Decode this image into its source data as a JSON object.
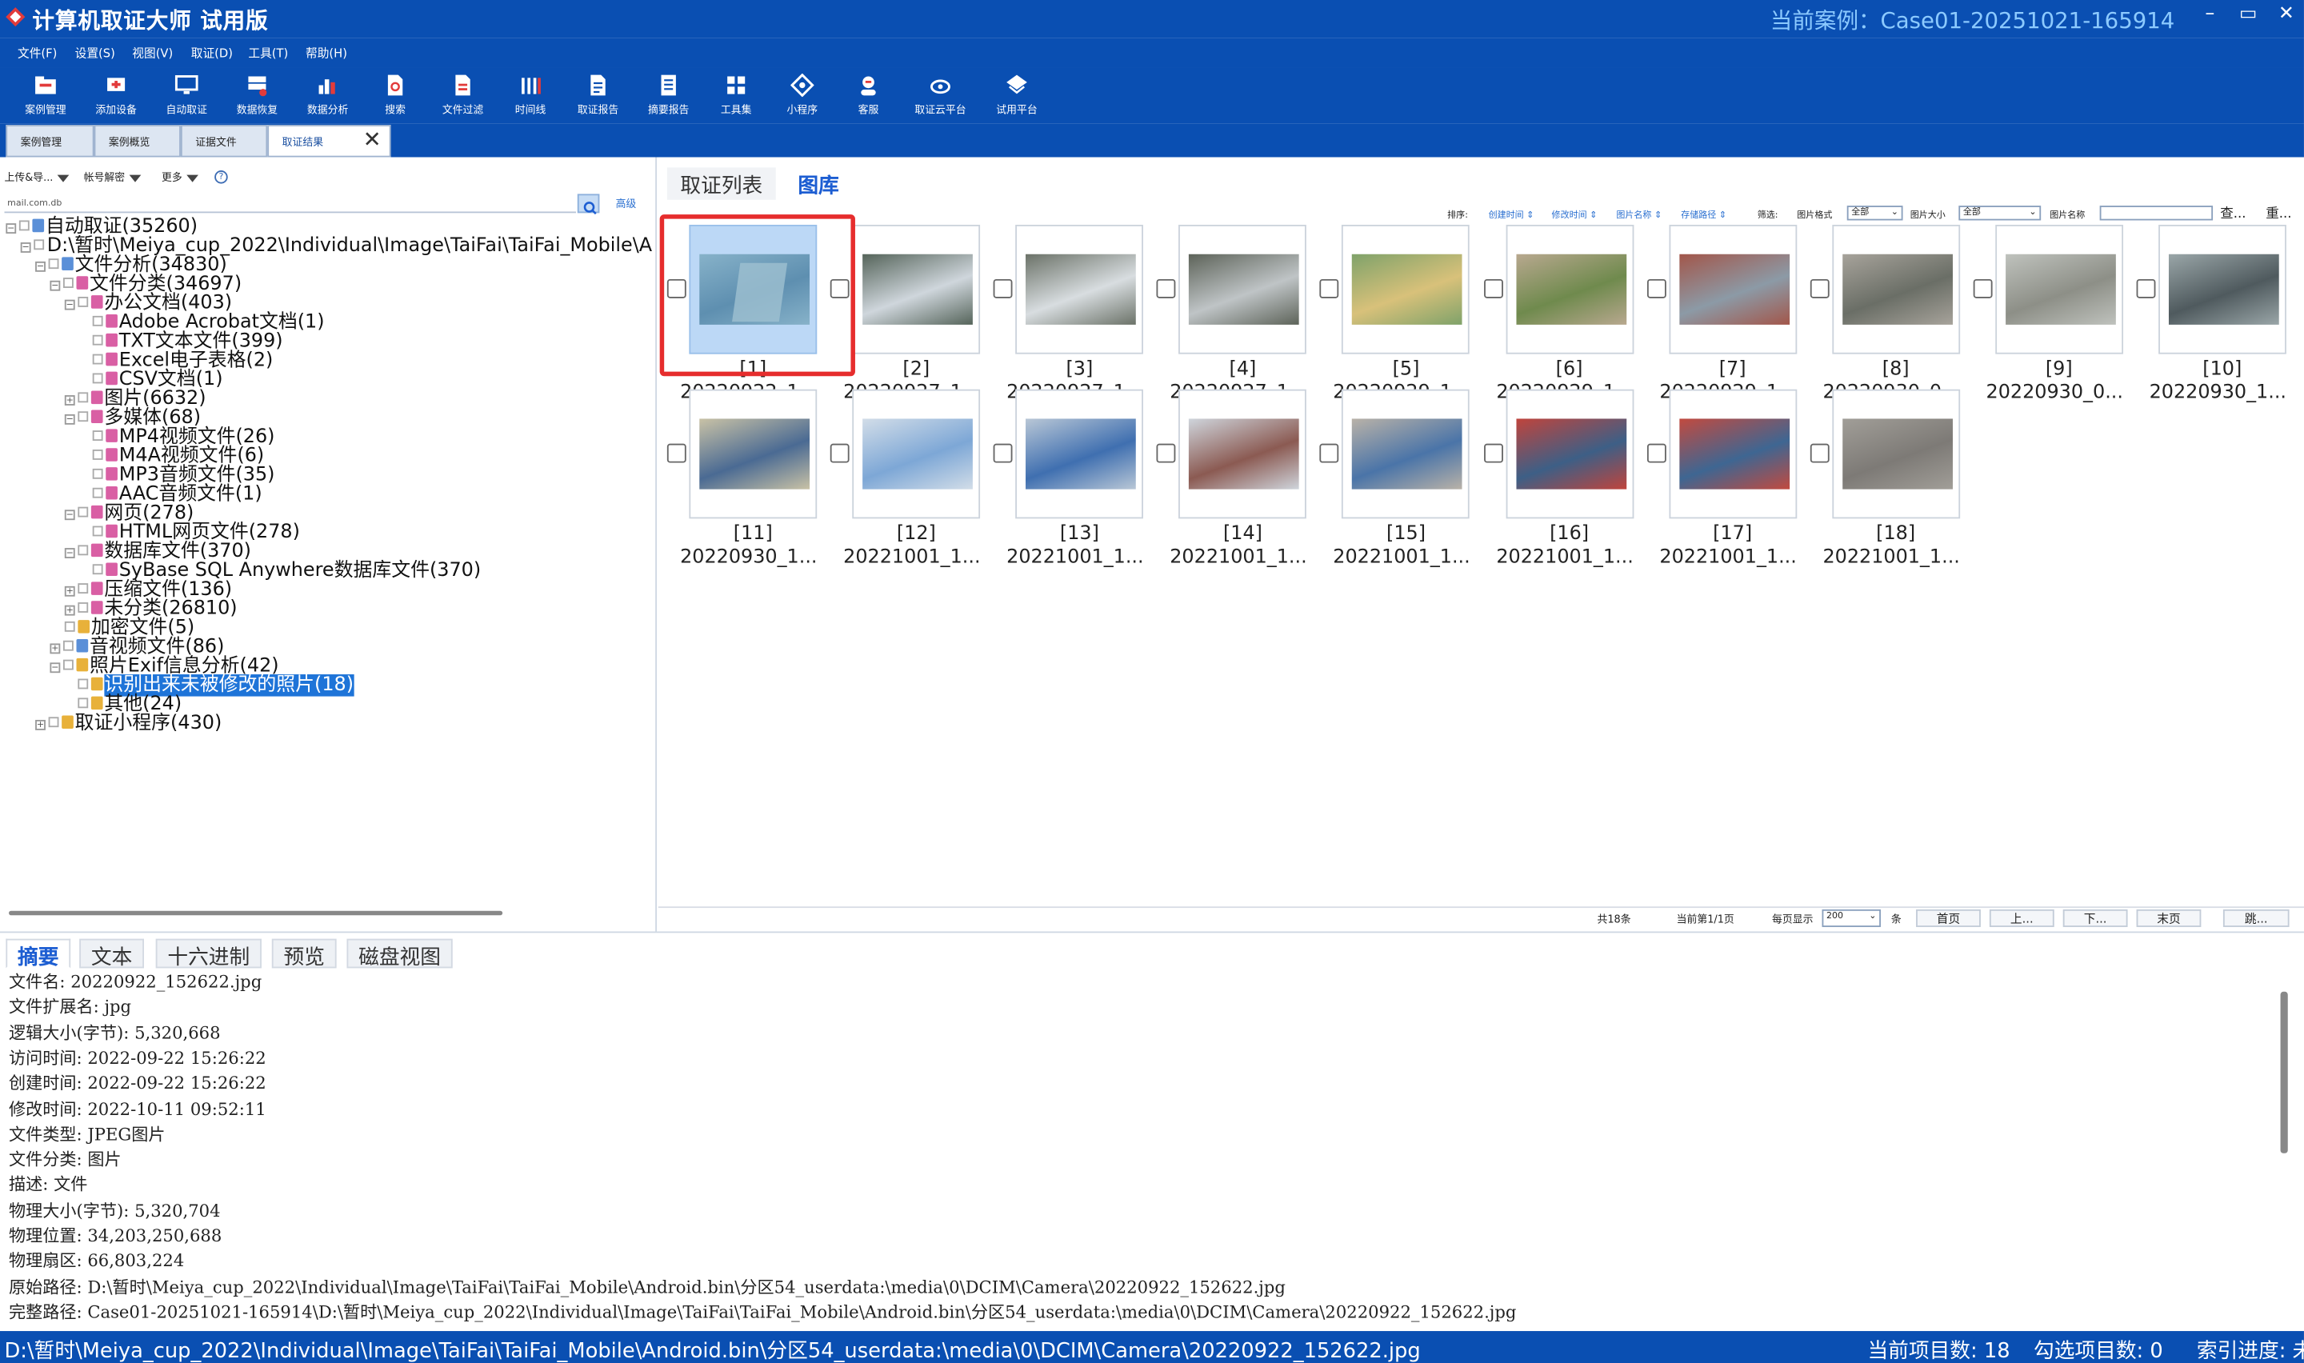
{
  "app": {
    "title": "计算机取证大师 试用版",
    "case": "当前案例：Case01-20251021-165914"
  },
  "window_buttons": [
    "–",
    "▭",
    "✕"
  ],
  "menu": [
    "文件(F)",
    "设置(S)",
    "视图(V)",
    "取证(D)",
    "工具(T)",
    "帮助(H)"
  ],
  "toolbar": [
    {
      "label": "案例管理",
      "icon": "folder-icon"
    },
    {
      "label": "添加设备",
      "icon": "add-device-icon"
    },
    {
      "label": "自动取证",
      "icon": "monitor-icon"
    },
    {
      "label": "数据恢复",
      "icon": "recover-icon"
    },
    {
      "label": "数据分析",
      "icon": "analysis-icon"
    },
    {
      "label": "搜索",
      "icon": "search-doc-icon"
    },
    {
      "label": "文件过滤",
      "icon": "filter-icon"
    },
    {
      "label": "时间线",
      "icon": "timeline-icon"
    },
    {
      "label": "取证报告",
      "icon": "report-icon"
    },
    {
      "label": "摘要报告",
      "icon": "summary-report-icon"
    },
    {
      "label": "工具集",
      "icon": "tools-grid-icon"
    },
    {
      "label": "小程序",
      "icon": "miniprogram-icon"
    },
    {
      "label": "客服",
      "icon": "support-icon"
    },
    {
      "label": "取证云平台",
      "icon": "cloud-icon"
    },
    {
      "label": "试用平台",
      "icon": "trial-icon"
    }
  ],
  "doc_tabs": [
    "案例管理",
    "案例概览",
    "证据文件",
    "取证结果"
  ],
  "left_toolbar": {
    "upload": "上传&导...",
    "decrypt": "帐号解密",
    "more": "更多",
    "help": "?"
  },
  "search": {
    "value": "mail.com.db",
    "advanced": "高级"
  },
  "tree": [
    "自动取证(35260)",
    "D:\\暂时\\Meiya_cup_2022\\Individual\\Image\\TaiFai\\TaiFai_Mobile\\A",
    "文件分析(34830)",
    "文件分类(34697)",
    "办公文档(403)",
    "Adobe Acrobat文档(1)",
    "TXT文本文件(399)",
    "Excel电子表格(2)",
    "CSV文档(1)",
    "图片(6632)",
    "多媒体(68)",
    "MP4视频文件(26)",
    "M4A视频文件(6)",
    "MP3音频文件(35)",
    "AAC音频文件(1)",
    "网页(278)",
    "HTML网页文件(278)",
    "数据库文件(370)",
    "SyBase SQL Anywhere数据库文件(370)",
    "压缩文件(136)",
    "未分类(26810)",
    "加密文件(5)",
    "音视频文件(86)",
    "照片Exif信息分析(42)",
    "识别出来未被修改的照片(18)",
    "其他(24)",
    "取证小程序(430)"
  ],
  "right_tabs": [
    "取证列表",
    "图库"
  ],
  "sortbar": {
    "sort": "排序:",
    "fields": [
      "创建时间 ⇕",
      "修改时间 ⇕",
      "图片名称 ⇕",
      "存储路径 ⇕"
    ],
    "filter": "筛选:",
    "format_label": "图片格式",
    "format_value": "全部",
    "size_label": "图片大小",
    "size_value": "全部",
    "name_label": "图片名称",
    "query": "查...",
    "reset": "重..."
  },
  "gallery": [
    {
      "num": "[1]",
      "name": "20220922_1..."
    },
    {
      "num": "[2]",
      "name": "20220927_1..."
    },
    {
      "num": "[3]",
      "name": "20220927_1..."
    },
    {
      "num": "[4]",
      "name": "20220927_1..."
    },
    {
      "num": "[5]",
      "name": "20220929_1..."
    },
    {
      "num": "[6]",
      "name": "20220929_1..."
    },
    {
      "num": "[7]",
      "name": "20220929_1..."
    },
    {
      "num": "[8]",
      "name": "20220930_0..."
    },
    {
      "num": "[9]",
      "name": "20220930_0..."
    },
    {
      "num": "[10]",
      "name": "20220930_1..."
    },
    {
      "num": "[11]",
      "name": "20220930_1..."
    },
    {
      "num": "[12]",
      "name": "20221001_1..."
    },
    {
      "num": "[13]",
      "name": "20221001_1..."
    },
    {
      "num": "[14]",
      "name": "20221001_1..."
    },
    {
      "num": "[15]",
      "name": "20221001_1..."
    },
    {
      "num": "[16]",
      "name": "20221001_1..."
    },
    {
      "num": "[17]",
      "name": "20221001_1..."
    },
    {
      "num": "[18]",
      "name": "20221001_1..."
    }
  ],
  "pager": {
    "total": "共18条",
    "current": "当前第1/1页",
    "per_page": "每页显示",
    "per_value": "200",
    "unit": "条",
    "first": "首页",
    "prev": "上...",
    "next": "下...",
    "last": "末页",
    "jump": "跳..."
  },
  "bottom_tabs": [
    "摘要",
    "文本",
    "十六进制",
    "预览",
    "磁盘视图"
  ],
  "properties": [
    "文件名: 20220922_152622.jpg",
    "文件扩展名: jpg",
    "逻辑大小(字节): 5,320,668",
    "访问时间: 2022-09-22 15:26:22",
    "创建时间: 2022-09-22 15:26:22",
    "修改时间: 2022-10-11 09:52:11",
    "文件类型: JPEG图片",
    "文件分类: 图片",
    "描述: 文件",
    "物理大小(字节): 5,320,704",
    "物理位置: 34,203,250,688",
    "物理扇区: 66,803,224",
    "原始路径: D:\\暂时\\Meiya_cup_2022\\Individual\\Image\\TaiFai\\TaiFai_Mobile\\Android.bin\\分区54_userdata:\\media\\0\\DCIM\\Camera\\20220922_152622.jpg",
    "完整路径: Case01-20251021-165914\\D:\\暂时\\Meiya_cup_2022\\Individual\\Image\\TaiFai\\TaiFai_Mobile\\Android.bin\\分区54_userdata:\\media\\0\\DCIM\\Camera\\20220922_152622.jpg"
  ],
  "status": {
    "path": "D:\\暂时\\Meiya_cup_2022\\Individual\\Image\\TaiFai\\TaiFai_Mobile\\Android.bin\\分区54_userdata:\\media\\0\\DCIM\\Camera\\20220922_152622.jpg",
    "items": "当前项目数: 18",
    "checked": "勾选项目数: 0",
    "index": "索引进度: 未"
  },
  "colors": {
    "accent": "#0a4fb2",
    "selection": "#1e74d8",
    "highlight_box": "#e62d2d",
    "case_text": "#8ccaff"
  }
}
